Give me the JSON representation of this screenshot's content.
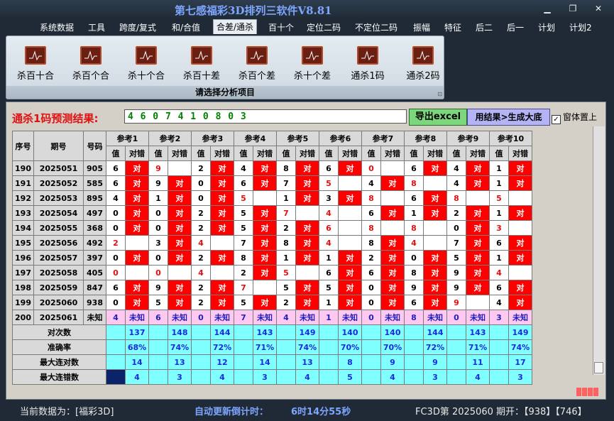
{
  "window": {
    "title": "第七感福彩3D排列三软件V8.81"
  },
  "menu": [
    "系统数据",
    "工具",
    "跨度/复式",
    "和/合值",
    "合差/通杀",
    "百十个",
    "定位二码",
    "不定位二码",
    "振幅",
    "特征",
    "后二",
    "后一",
    "计划",
    "计划2"
  ],
  "active_menu": 4,
  "ribbon": {
    "buttons": [
      "杀百十合",
      "杀百个合",
      "杀十个合",
      "杀百十差",
      "杀百个差",
      "杀十个差",
      "通杀1码",
      "通杀2码"
    ],
    "caption": "请选择分析项目"
  },
  "prediction": {
    "label": "通杀1码预测结果:",
    "value": "4 6 0 7 4 1 0 8 0 3"
  },
  "buttons": {
    "export": "导出excel",
    "generate": "用结果>生成大底",
    "on_top": "窗体置上"
  },
  "table": {
    "headers": {
      "seq": "序号",
      "issue": "期号",
      "number": "号码",
      "value": "值",
      "result": "对错"
    },
    "refs": [
      "参考1",
      "参考2",
      "参考3",
      "参考4",
      "参考5",
      "参考6",
      "参考7",
      "参考8",
      "参考9",
      "参考10"
    ],
    "rows": [
      {
        "seq": "190",
        "issue": "2025051",
        "num": "905",
        "v": [
          "6",
          "9",
          "2",
          "4",
          "8",
          "6",
          "0",
          "6",
          "4",
          "1"
        ],
        "ok": [
          1,
          0,
          1,
          1,
          1,
          1,
          0,
          1,
          1,
          1
        ],
        "red": [
          0,
          1,
          0,
          0,
          0,
          0,
          1,
          0,
          0,
          0
        ]
      },
      {
        "seq": "191",
        "issue": "2025052",
        "num": "585",
        "v": [
          "6",
          "9",
          "0",
          "6",
          "7",
          "5",
          "4",
          "8",
          "4",
          "1"
        ],
        "ok": [
          1,
          1,
          1,
          1,
          1,
          0,
          1,
          0,
          1,
          1
        ],
        "red": [
          0,
          0,
          0,
          0,
          0,
          1,
          0,
          1,
          0,
          0
        ]
      },
      {
        "seq": "192",
        "issue": "2025053",
        "num": "895",
        "v": [
          "4",
          "1",
          "0",
          "5",
          "1",
          "3",
          "8",
          "6",
          "8",
          "5"
        ],
        "ok": [
          1,
          1,
          1,
          0,
          1,
          1,
          0,
          1,
          0,
          0
        ],
        "red": [
          0,
          0,
          0,
          1,
          0,
          0,
          1,
          0,
          1,
          1
        ]
      },
      {
        "seq": "193",
        "issue": "2025054",
        "num": "497",
        "v": [
          "0",
          "0",
          "2",
          "5",
          "7",
          "4",
          "6",
          "1",
          "2",
          "1"
        ],
        "ok": [
          1,
          1,
          1,
          1,
          0,
          0,
          1,
          1,
          1,
          1
        ],
        "red": [
          0,
          0,
          0,
          0,
          1,
          1,
          0,
          0,
          0,
          0
        ]
      },
      {
        "seq": "194",
        "issue": "2025055",
        "num": "368",
        "v": [
          "0",
          "0",
          "2",
          "5",
          "2",
          "6",
          "8",
          "8",
          "0",
          "3"
        ],
        "ok": [
          1,
          1,
          1,
          1,
          1,
          0,
          0,
          0,
          1,
          0
        ],
        "red": [
          0,
          0,
          0,
          0,
          0,
          1,
          1,
          1,
          0,
          1
        ]
      },
      {
        "seq": "195",
        "issue": "2025056",
        "num": "492",
        "v": [
          "2",
          "3",
          "4",
          "7",
          "8",
          "4",
          "8",
          "4",
          "7",
          "6"
        ],
        "ok": [
          0,
          1,
          0,
          1,
          1,
          0,
          1,
          0,
          1,
          1
        ],
        "red": [
          1,
          0,
          1,
          0,
          0,
          1,
          0,
          1,
          0,
          0
        ]
      },
      {
        "seq": "196",
        "issue": "2025057",
        "num": "397",
        "v": [
          "0",
          "0",
          "2",
          "8",
          "1",
          "1",
          "2",
          "0",
          "5",
          "1"
        ],
        "ok": [
          1,
          1,
          1,
          1,
          1,
          1,
          1,
          1,
          1,
          1
        ],
        "red": [
          0,
          0,
          0,
          0,
          0,
          0,
          0,
          0,
          0,
          0
        ]
      },
      {
        "seq": "197",
        "issue": "2025058",
        "num": "405",
        "v": [
          "0",
          "0",
          "4",
          "2",
          "5",
          "6",
          "6",
          "8",
          "9",
          "4"
        ],
        "ok": [
          0,
          0,
          0,
          1,
          0,
          1,
          1,
          1,
          1,
          0
        ],
        "red": [
          1,
          1,
          1,
          0,
          1,
          0,
          0,
          0,
          0,
          1
        ]
      },
      {
        "seq": "198",
        "issue": "2025059",
        "num": "847",
        "v": [
          "6",
          "9",
          "2",
          "7",
          "5",
          "5",
          "0",
          "9",
          "9",
          "6"
        ],
        "ok": [
          1,
          1,
          1,
          0,
          1,
          1,
          1,
          1,
          1,
          1
        ],
        "red": [
          0,
          0,
          0,
          1,
          0,
          0,
          0,
          0,
          0,
          0
        ]
      },
      {
        "seq": "199",
        "issue": "2025060",
        "num": "938",
        "v": [
          "0",
          "5",
          "2",
          "5",
          "2",
          "1",
          "0",
          "6",
          "9",
          "4"
        ],
        "ok": [
          1,
          1,
          1,
          1,
          1,
          1,
          1,
          1,
          0,
          1
        ],
        "red": [
          0,
          0,
          0,
          0,
          0,
          0,
          0,
          0,
          1,
          0
        ]
      },
      {
        "seq": "200",
        "issue": "2025061",
        "num": "未知",
        "v": [
          "4",
          "6",
          "0",
          "7",
          "4",
          "1",
          "0",
          "8",
          "0",
          "3"
        ],
        "unknown": "未知"
      }
    ],
    "summary": [
      {
        "label": "对次数",
        "values": [
          "137",
          "148",
          "144",
          "143",
          "149",
          "140",
          "140",
          "144",
          "143",
          "149"
        ]
      },
      {
        "label": "准确率",
        "values": [
          "68%",
          "74%",
          "72%",
          "71%",
          "74%",
          "70%",
          "70%",
          "72%",
          "71%",
          "74%"
        ]
      },
      {
        "label": "最大连对数",
        "values": [
          "14",
          "13",
          "12",
          "14",
          "13",
          "8",
          "9",
          "9",
          "11",
          "17"
        ]
      },
      {
        "label": "最大连错数",
        "values": [
          "4",
          "3",
          "4",
          "3",
          "4",
          "5",
          "4",
          "3",
          "4",
          "3"
        ]
      }
    ]
  },
  "status": {
    "current": "当前数据为：[福彩3D]",
    "countdown_label": "自动更新倒计时：",
    "countdown": "6时14分55秒",
    "draw": "FC3D第  2025060  期开：【938】【746】"
  },
  "colors": {
    "ok": "#ff0000",
    "unknown": "#ffc8f0",
    "summary": "#80ffff",
    "accent": "#7ea6ff"
  }
}
